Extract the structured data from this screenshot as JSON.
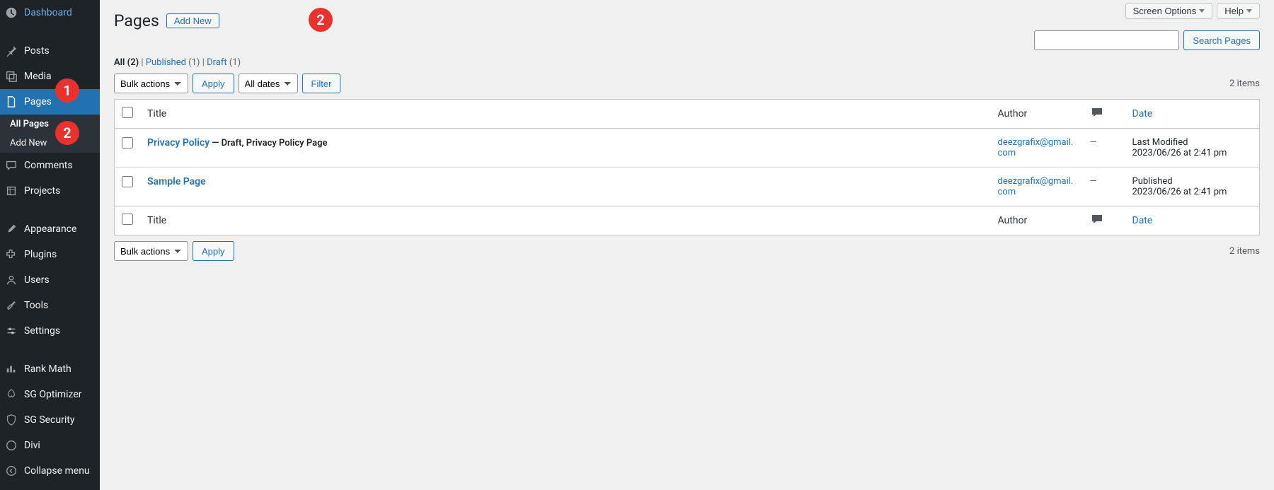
{
  "sidebar": {
    "items": [
      {
        "label": "Dashboard"
      },
      {
        "label": "Posts"
      },
      {
        "label": "Media"
      },
      {
        "label": "Pages"
      },
      {
        "label": "Comments"
      },
      {
        "label": "Projects"
      },
      {
        "label": "Appearance"
      },
      {
        "label": "Plugins"
      },
      {
        "label": "Users"
      },
      {
        "label": "Tools"
      },
      {
        "label": "Settings"
      },
      {
        "label": "Rank Math"
      },
      {
        "label": "SG Optimizer"
      },
      {
        "label": "SG Security"
      },
      {
        "label": "Divi"
      },
      {
        "label": "Collapse menu"
      }
    ],
    "submenu": [
      {
        "label": "All Pages"
      },
      {
        "label": "Add New"
      }
    ]
  },
  "annotations": {
    "badge1": "1",
    "badge2": "2",
    "badge3": "2"
  },
  "top": {
    "screen_options": "Screen Options",
    "help": "Help"
  },
  "header": {
    "title": "Pages",
    "add_new": "Add New"
  },
  "filters": {
    "all_label": "All",
    "all_count": "(2)",
    "published_label": "Published",
    "published_count": "(1)",
    "draft_label": "Draft",
    "draft_count": "(1)",
    "sep": " | "
  },
  "controls": {
    "bulk_actions": "Bulk actions",
    "apply": "Apply",
    "all_dates": "All dates",
    "filter": "Filter",
    "search_pages": "Search Pages",
    "items_count": "2 items"
  },
  "table": {
    "columns": {
      "title": "Title",
      "author": "Author",
      "date": "Date"
    },
    "rows": [
      {
        "title": "Privacy Policy",
        "suffix": " — Draft, Privacy Policy Page",
        "author": "deezgrafix@gmail.com",
        "comments": "—",
        "date_label": "Last Modified",
        "date_value": "2023/06/26 at 2:41 pm"
      },
      {
        "title": "Sample Page",
        "suffix": "",
        "author": "deezgrafix@gmail.com",
        "comments": "—",
        "date_label": "Published",
        "date_value": "2023/06/26 at 2:41 pm"
      }
    ]
  }
}
